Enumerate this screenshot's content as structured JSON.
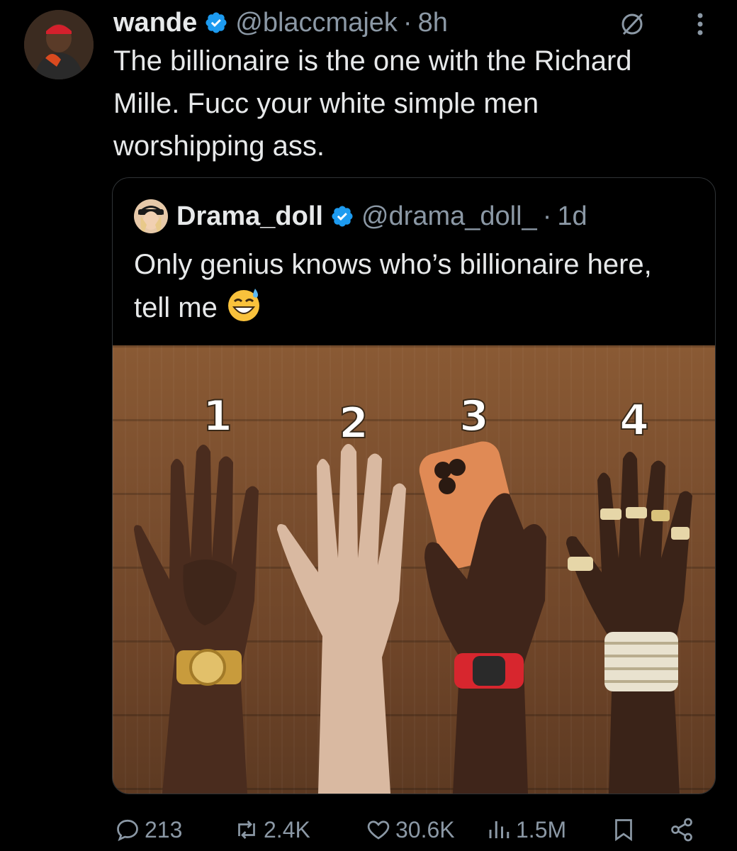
{
  "tweet": {
    "author_name": "wande",
    "author_handle": "@blaccmajek",
    "separator": "·",
    "time": "8h",
    "text": "The billionaire is the one with the Richard Mille. Fucc your white simple men worshipping ass."
  },
  "quote": {
    "author_name": "Drama_doll",
    "author_handle": "@drama_doll_",
    "separator": "·",
    "time": "1d",
    "text": "Only genius knows who’s billionaire here, tell me",
    "image_labels": [
      "1",
      "2",
      "3",
      "4"
    ]
  },
  "actions": {
    "replies": "213",
    "reposts": "2.4K",
    "likes": "30.6K",
    "views": "1.5M"
  },
  "colors": {
    "background": "#000000",
    "text": "#e7e9ea",
    "secondary": "#8b98a5",
    "verified": "#1d9bf0",
    "border": "#2f3336"
  },
  "icons": [
    "verified-badge-icon",
    "grok-icon",
    "more-icon",
    "reply-icon",
    "repost-icon",
    "like-icon",
    "views-icon",
    "bookmark-icon",
    "share-icon"
  ]
}
